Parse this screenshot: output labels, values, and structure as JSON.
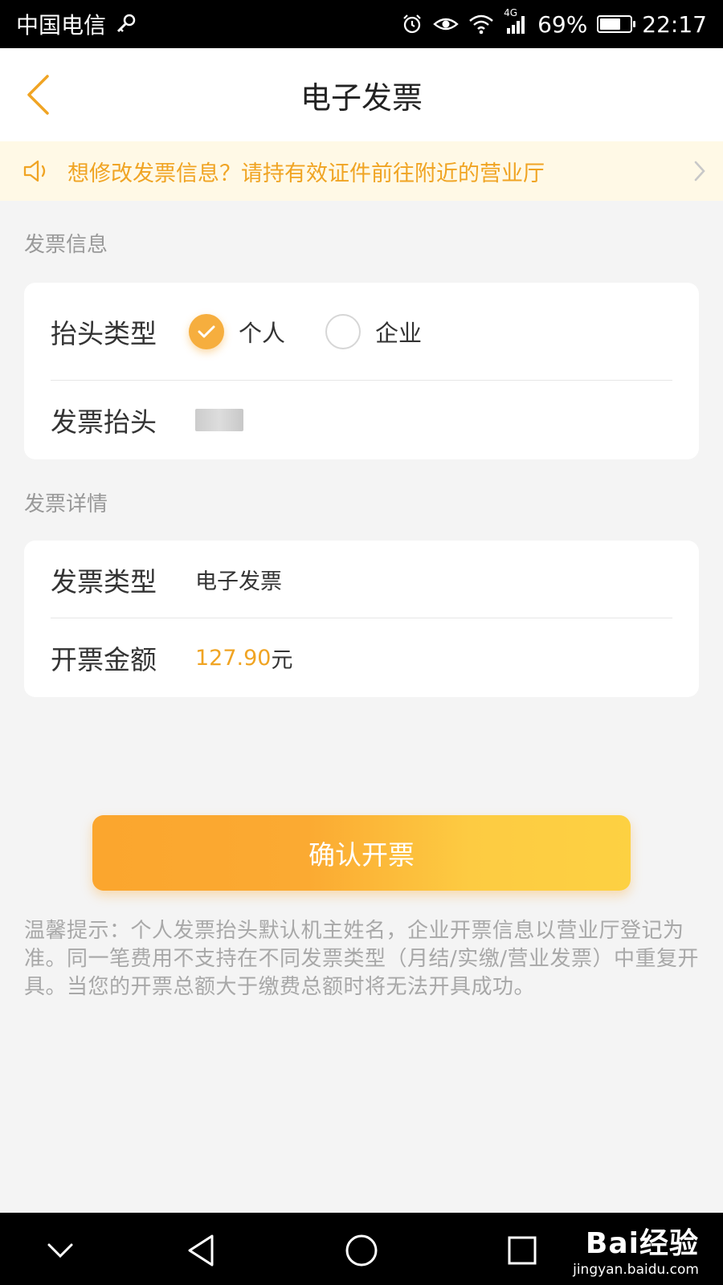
{
  "status_bar": {
    "carrier": "中国电信",
    "network": "4G",
    "battery": "69%",
    "time": "22:17",
    "battery_level": 0.69
  },
  "header": {
    "title": "电子发票",
    "back_icon": "chevron-left-icon"
  },
  "notice": {
    "text": "想修改发票信息？请持有效证件前往附近的营业厅",
    "icon": "speaker-icon"
  },
  "invoice_info": {
    "section_label": "发票信息",
    "title_type_label": "抬头类型",
    "options": [
      {
        "label": "个人",
        "checked": true
      },
      {
        "label": "企业",
        "checked": false
      }
    ],
    "invoice_title_label": "发票抬头"
  },
  "invoice_detail": {
    "section_label": "发票详情",
    "type_label": "发票类型",
    "type_value": "电子发票",
    "amount_label": "开票金额",
    "amount_value": "127.90",
    "amount_unit": "元"
  },
  "confirm_button": "确认开票",
  "tips": "温馨提示：个人发票抬头默认机主姓名，企业开票信息以营业厅登记为准。同一笔费用不支持在不同发票类型（月结/实缴/营业发票）中重复开具。当您的开票总额大于缴费总额时将无法开具成功。",
  "watermark": {
    "top": "Bai经验",
    "bottom": "jingyan.baidu.com"
  },
  "colors": {
    "accent": "#f6ae3e",
    "notice_text": "#f0a423",
    "notice_bg": "#fff9e6"
  }
}
